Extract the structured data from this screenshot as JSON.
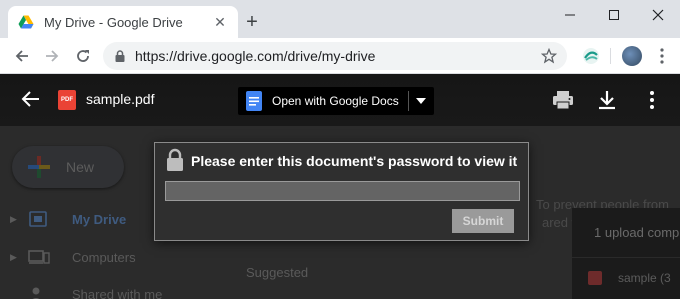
{
  "browser": {
    "tab": {
      "title": "My Drive - Google Drive"
    },
    "address_bar": {
      "url": "https://drive.google.com/drive/my-drive"
    }
  },
  "viewer": {
    "file_name": "sample.pdf",
    "file_badge": "PDF",
    "open_with_label": "Open with Google Docs"
  },
  "password_dialog": {
    "title": "Please enter this document's password to view it",
    "input_value": "",
    "submit_label": "Submit"
  },
  "drive_background": {
    "new_label": "New",
    "sidebar": [
      {
        "label": "My Drive",
        "icon": "my-drive-icon",
        "active": true
      },
      {
        "label": "Computers",
        "icon": "computers-icon",
        "active": false
      },
      {
        "label": "Shared with me",
        "icon": "shared-icon",
        "active": false
      }
    ],
    "suggested_label": "Suggested",
    "hint_line1": "To prevent people from",
    "hint_line2": "ared wi",
    "upload_status": "1 upload comp",
    "upload_file": "sample (3"
  },
  "colors": {
    "viewer_header": "#161616",
    "dialog_bg": "#2f2f2f",
    "pdf_red": "#ea4335",
    "docs_blue": "#4285f4"
  }
}
